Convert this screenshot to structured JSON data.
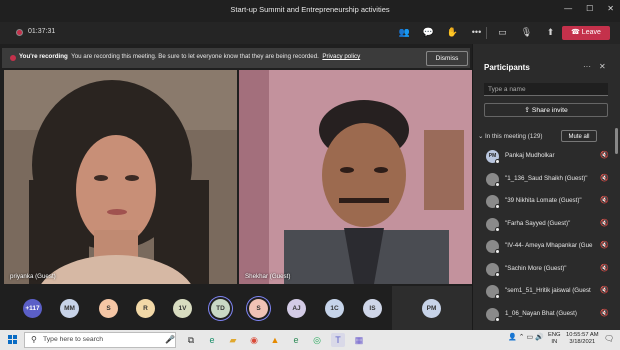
{
  "window": {
    "title": "Start-up Summit and Entrepreneurship activities",
    "minimize": "—",
    "maximize": "☐",
    "close": "✕"
  },
  "toolbar": {
    "timer": "01:37:31",
    "leave_label": "Leave"
  },
  "banner": {
    "bold": "You're recording",
    "text": "You are recording this meeting. Be sure to let everyone know that they are being recorded.",
    "link": "Privacy policy",
    "dismiss": "Dismiss"
  },
  "videos": [
    {
      "name": "priyanka (Guest)"
    },
    {
      "name": "Shekhar (Guest)"
    }
  ],
  "strip": {
    "more": "+117",
    "avatars": [
      {
        "initials": "MM",
        "color": "#c7d3e8"
      },
      {
        "initials": "S",
        "color": "#f5c6a5"
      },
      {
        "initials": "R",
        "color": "#f2d8a7"
      },
      {
        "initials": "1V",
        "color": "#d8dcc0"
      },
      {
        "initials": "TD",
        "color": "#c9d8c5"
      },
      {
        "initials": "S",
        "color": "#f0c2b5"
      },
      {
        "initials": "AJ",
        "color": "#d3cbe6"
      },
      {
        "initials": "1C",
        "color": "#c6d4ea"
      },
      {
        "initials": "IS",
        "color": "#cfd6e8"
      }
    ],
    "tile": "PM"
  },
  "panel": {
    "title": "Participants",
    "more": "···",
    "close": "✕",
    "search_placeholder": "Type a name",
    "share": "Share invite",
    "section": "In this meeting (129)",
    "mute_all": "Mute all",
    "participants": [
      {
        "initials": "PM",
        "name": "Pankaj Mudholkar"
      },
      {
        "initials": "",
        "name": "\"1_136_Saud Shaikh (Guest)\""
      },
      {
        "initials": "",
        "name": "\"39 Nikhita Lomate (Guest)\""
      },
      {
        "initials": "",
        "name": "\"Farha Sayyed (Guest)\""
      },
      {
        "initials": "",
        "name": "\"IV-44- Ameya Mhapankar (Gue"
      },
      {
        "initials": "",
        "name": "\"Sachin More (Guest)\""
      },
      {
        "initials": "",
        "name": "\"sem1_51_Hritik jaiswal (Guest"
      },
      {
        "initials": "",
        "name": "1_06_Nayan Bhat (Guest)"
      }
    ]
  },
  "taskbar": {
    "search": "Type here to search",
    "lang1": "ENG",
    "lang2": "IN",
    "time": "10:55:57 AM",
    "date": "3/18/2021"
  }
}
